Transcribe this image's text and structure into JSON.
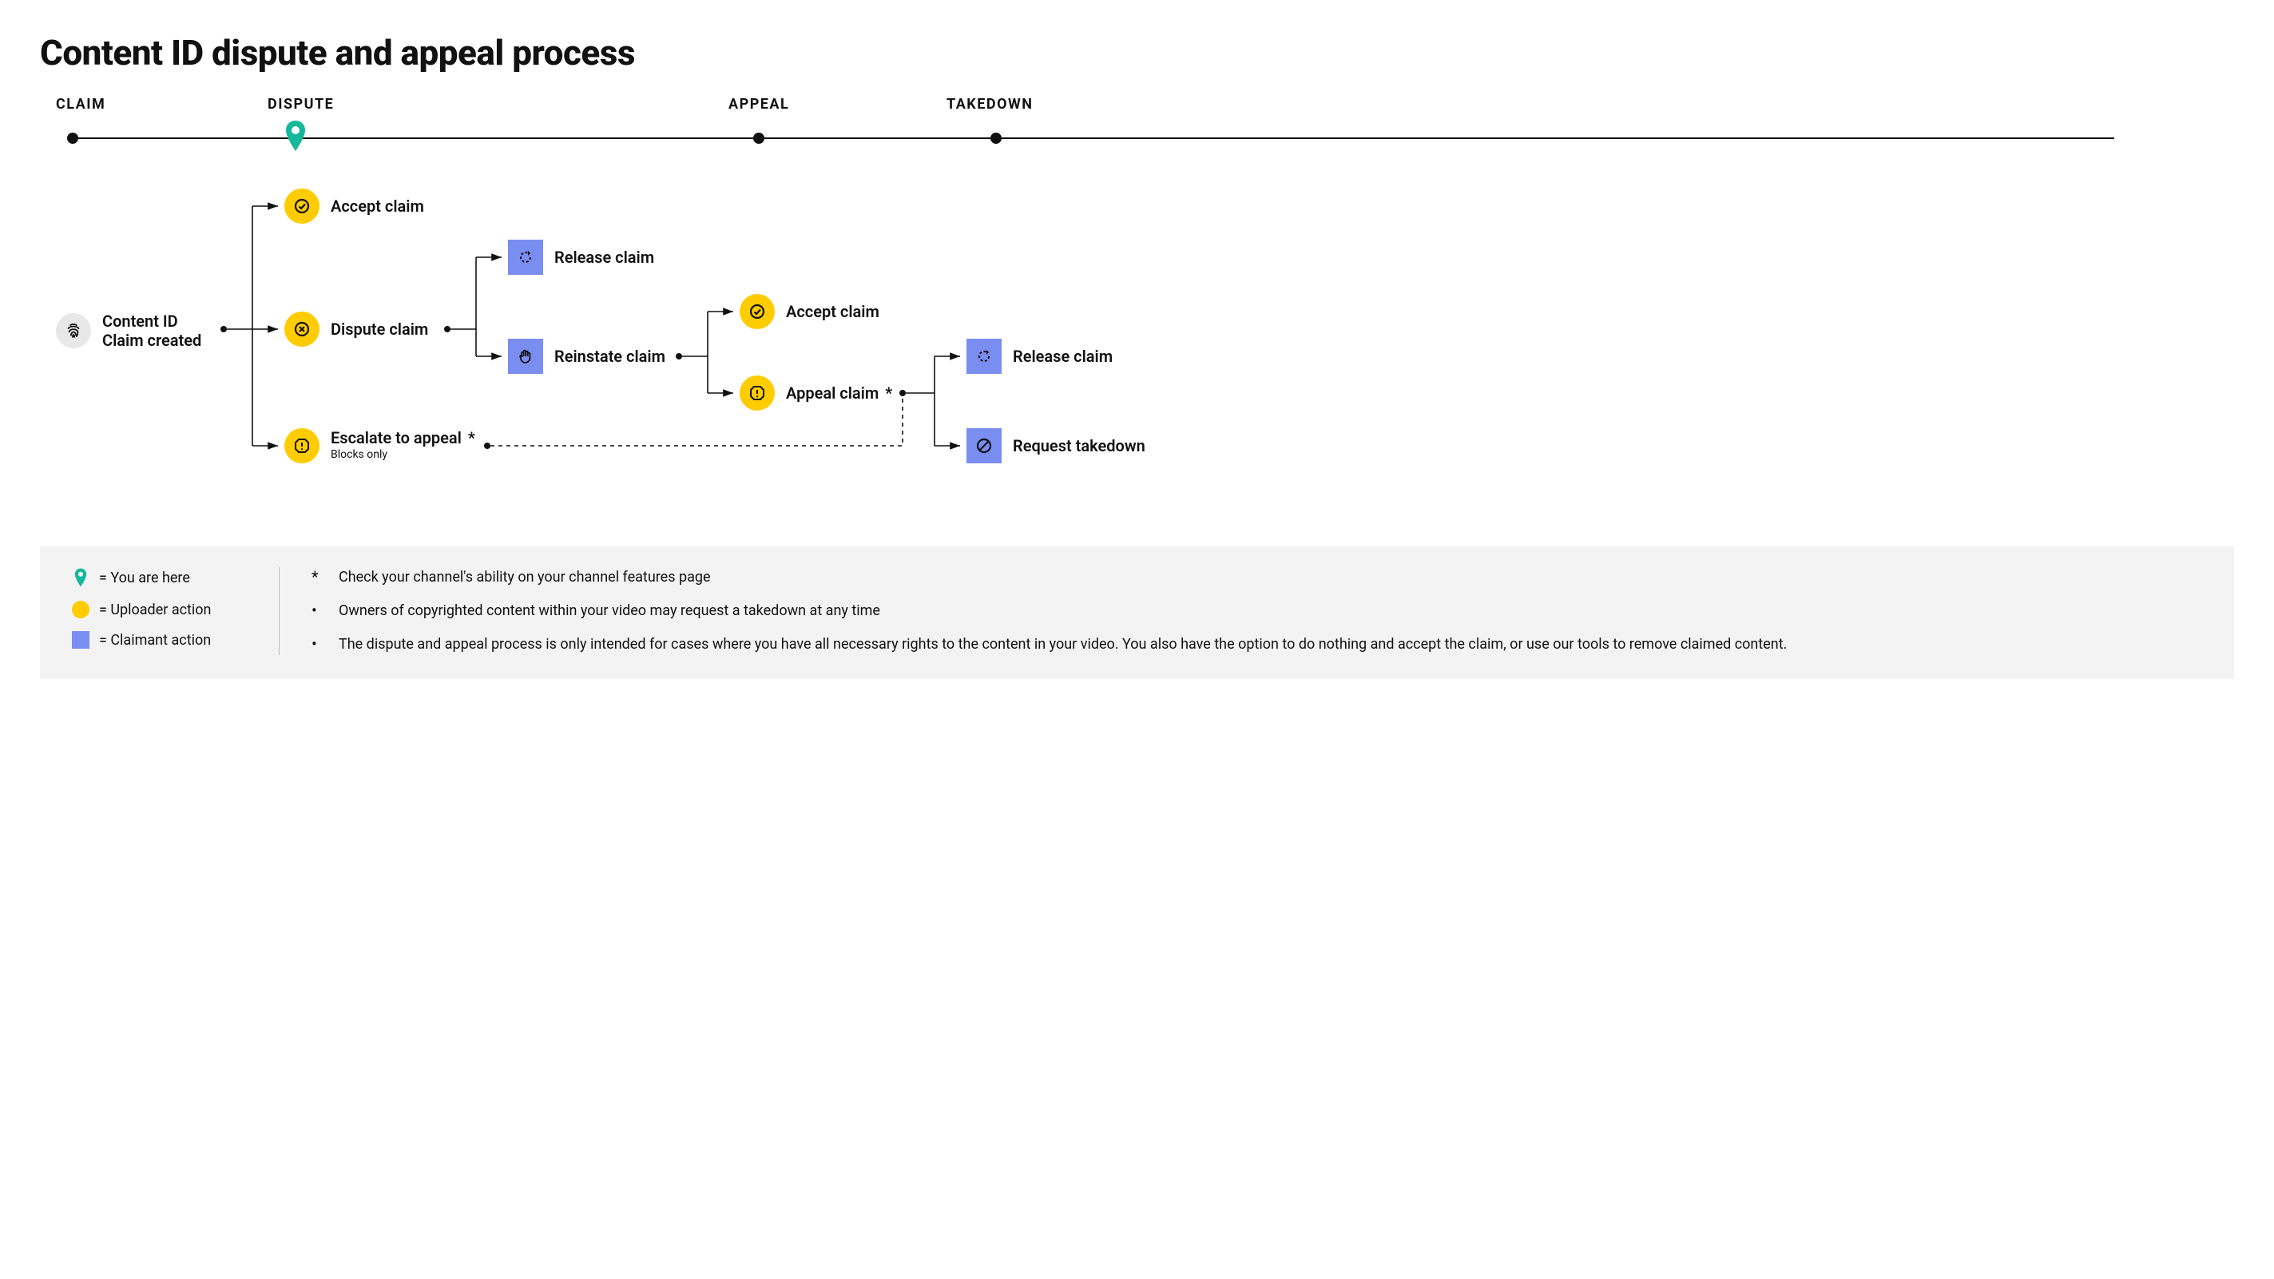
{
  "title": "Content ID dispute and appeal process",
  "stages": {
    "claim": "CLAIM",
    "dispute": "DISPUTE",
    "appeal": "APPEAL",
    "takedown": "TAKEDOWN"
  },
  "nodes": {
    "start_l1": "Content ID",
    "start_l2": "Claim created",
    "accept_claim": "Accept claim",
    "dispute_claim": "Dispute claim",
    "escalate": "Escalate to appeal",
    "escalate_sub": "Blocks only",
    "release_claim": "Release claim",
    "reinstate_claim": "Reinstate claim",
    "accept_claim2": "Accept claim",
    "appeal_claim": "Appeal claim",
    "release_claim2": "Release claim",
    "request_takedown": "Request takedown",
    "star": "*"
  },
  "legend": {
    "here": "= You are here",
    "uploader": "= Uploader action",
    "claimant": "= Claimant action"
  },
  "notes": {
    "star_note": "Check your channel's ability on your channel features page",
    "b1": "Owners of copyrighted content within your video may request a takedown at any time",
    "b2": "The dispute and appeal process is only intended for cases where you have all necessary rights to the content in your video. You also have the option to do nothing and accept the claim, or use our tools to remove claimed content."
  },
  "colors": {
    "yellow": "#ffcc00",
    "blue": "#7a8df0",
    "teal": "#15b89a",
    "gray": "#e8e8e8"
  }
}
